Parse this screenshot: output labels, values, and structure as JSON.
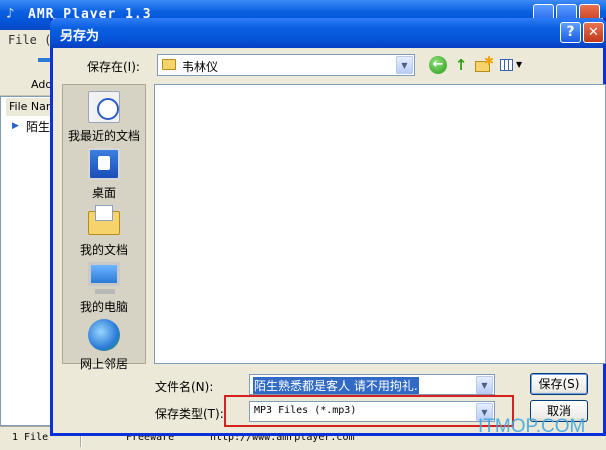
{
  "app": {
    "title": "AMR Player 1.3",
    "menu_file": "File (",
    "toolbar_add": "Add",
    "list_header": "File Nam",
    "list_row": "陌生",
    "status": {
      "count": "1 File",
      "license": "Freeware",
      "url": "http://www.amrplayer.com"
    }
  },
  "dialog": {
    "title": "另存为",
    "help_button": "?",
    "close_button": "✕",
    "save_in_label": "保存在(I):",
    "save_in_value": "韦林仪",
    "places": {
      "recent": "我最近的文档",
      "desktop": "桌面",
      "my_documents": "我的文档",
      "my_computer": "我的电脑",
      "network": "网上邻居"
    },
    "filename_label": "文件名(N):",
    "filename_value": "陌生熟悉都是客人 请不用拘礼.",
    "filetype_label": "保存类型(T):",
    "filetype_value": "MP3 Files (*.mp3)",
    "save_button": "保存(S)",
    "cancel_button": "取消"
  },
  "icons": {
    "back": "back-arrow-icon",
    "up": "up-folder-icon",
    "new_folder": "new-folder-icon",
    "views": "views-menu-icon"
  },
  "watermark": "ITMOP.COM"
}
